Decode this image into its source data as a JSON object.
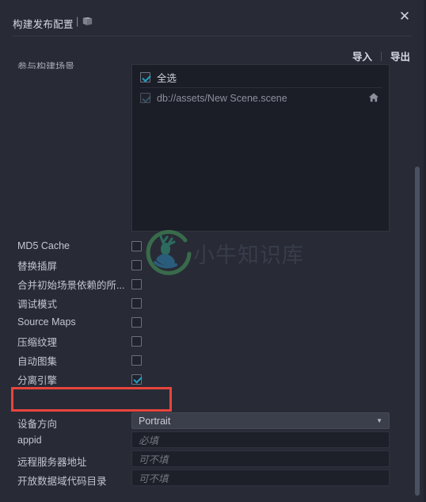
{
  "window": {
    "title": "构建发布配置",
    "title_separator": "|",
    "doc_icon": "book-icon",
    "close_icon": "✕"
  },
  "toolbar": {
    "import_label": "导入",
    "export_label": "导出"
  },
  "scene_section": {
    "label": "参与构建场景",
    "rows": [
      {
        "label": "全选",
        "checked": true,
        "dimmed": false,
        "home": false
      },
      {
        "label": "db://assets/New Scene.scene",
        "checked": true,
        "dimmed": true,
        "home": true
      }
    ]
  },
  "watermark": {
    "text": "小牛知识库",
    "logo_icon": "deer-circle-logo"
  },
  "options": [
    {
      "label": "MD5 Cache",
      "checked": false
    },
    {
      "label": "替换插屏",
      "checked": false
    },
    {
      "label": "合并初始场景依赖的所...",
      "checked": false
    },
    {
      "label": "调试模式",
      "checked": false
    },
    {
      "label": "Source Maps",
      "checked": false
    },
    {
      "label": "压缩纹理",
      "checked": false
    },
    {
      "label": "自动图集",
      "checked": false
    },
    {
      "label": "分离引擎",
      "checked": true,
      "highlighted": true
    }
  ],
  "fields": [
    {
      "type": "select",
      "label": "设备方向",
      "value": "Portrait",
      "arrow_icon": "chevron-down-icon"
    },
    {
      "type": "input",
      "label": "appid",
      "value": "",
      "placeholder": "必填"
    },
    {
      "type": "input",
      "label": "远程服务器地址",
      "value": "",
      "placeholder": "可不填"
    },
    {
      "type": "input",
      "label": "开放数据域代码目录",
      "value": "",
      "placeholder": "可不填"
    }
  ],
  "colors": {
    "background": "#282b36",
    "panel": "#1b1d27",
    "accent_check": "#2e9fbe",
    "highlight_red": "#e8453c",
    "scrollbar": "#4b5161"
  },
  "scrollbar": {
    "orientation": "vertical"
  }
}
